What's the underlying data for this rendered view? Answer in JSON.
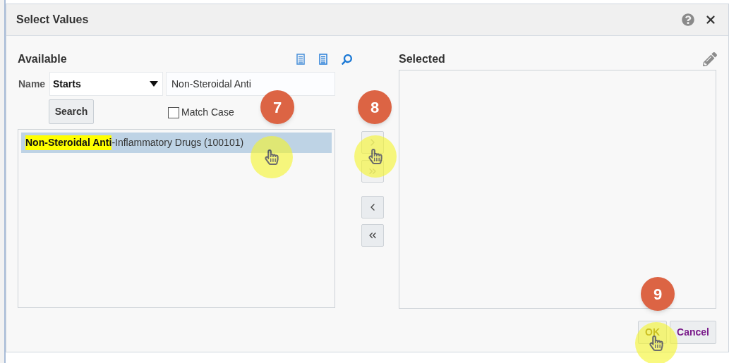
{
  "dialog": {
    "title": "Select Values"
  },
  "available": {
    "heading": "Available",
    "name_label": "Name",
    "operator": "Starts",
    "search_text": "Non-Steroidal Anti",
    "search_button": "Search",
    "match_case": {
      "label": "Match Case",
      "checked": false
    },
    "items": [
      {
        "label": "**Non-Steroidal Anti**-Inflammatory Drugs (100101)",
        "selected": true
      }
    ]
  },
  "shuttle": [
    {
      "kind": "move",
      "disabled": true
    },
    {
      "kind": "move_all",
      "disabled": true
    },
    {
      "kind": "remove",
      "disabled": false
    },
    {
      "kind": "remove_all",
      "disabled": false
    }
  ],
  "selected": {
    "heading": "Selected"
  },
  "buttons": [
    {
      "label": "OK",
      "disabled": true
    },
    {
      "label": "Cancel",
      "disabled": false
    }
  ],
  "callouts": [
    "7",
    "8",
    "9"
  ]
}
